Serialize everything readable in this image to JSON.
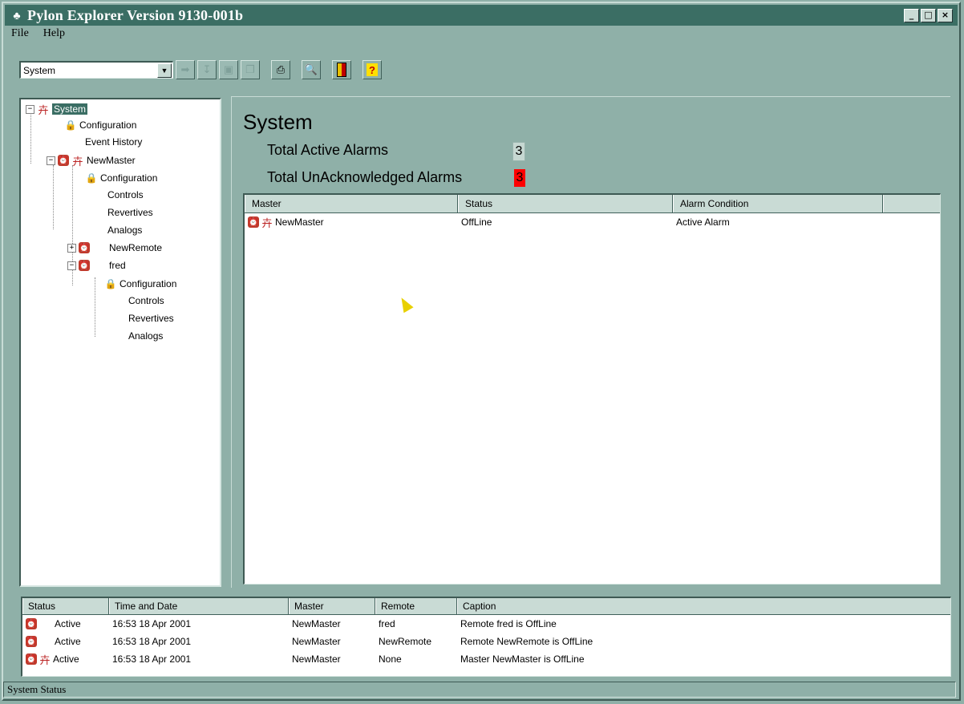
{
  "window": {
    "title": "Pylon Explorer Version 9130-001b",
    "controls": {
      "minimize": "_",
      "maximize": "□",
      "close": "×"
    }
  },
  "menu": {
    "file": "File",
    "help": "Help"
  },
  "toolbar": {
    "combo_value": "System",
    "buttons": [
      "forward-icon",
      "import-icon",
      "save-icon",
      "copy-icon",
      "print-icon",
      "search-icon",
      "book-icon",
      "help-icon"
    ]
  },
  "tree": {
    "root": "System",
    "items": {
      "config1": "Configuration",
      "event_history": "Event History",
      "newmaster": "NewMaster",
      "config2": "Configuration",
      "controls1": "Controls",
      "revertives1": "Revertives",
      "analogs1": "Analogs",
      "newremote": "NewRemote",
      "fred": "fred",
      "config3": "Configuration",
      "controls2": "Controls",
      "revertives2": "Revertives",
      "analogs2": "Analogs"
    }
  },
  "main": {
    "heading": "System",
    "total_active_label": "Total Active Alarms",
    "total_active_value": "3",
    "total_unack_label": "Total UnAcknowledged Alarms",
    "total_unack_value": "3",
    "columns": [
      "Master",
      "Status",
      "Alarm Condition",
      ""
    ],
    "rows": [
      {
        "master": "NewMaster",
        "status": "OffLine",
        "condition": "Active Alarm"
      }
    ]
  },
  "status_list": {
    "columns": [
      "Status",
      "Time and Date",
      "Master",
      "Remote",
      "Caption"
    ],
    "rows": [
      {
        "status": "Active",
        "time": "16:53 18 Apr 2001",
        "master": "NewMaster",
        "remote": "fred",
        "caption": "Remote fred is OffLine"
      },
      {
        "status": "Active",
        "time": "16:53 18 Apr 2001",
        "master": "NewMaster",
        "remote": "NewRemote",
        "caption": "Remote NewRemote is OffLine"
      },
      {
        "status": "Active",
        "time": "16:53 18 Apr 2001",
        "master": "NewMaster",
        "remote": "None",
        "caption": "Master NewMaster is OffLine"
      }
    ]
  },
  "statusbar": {
    "text": "System Status"
  },
  "colors": {
    "window_bg": "#8fb0a8",
    "title_bg": "#3b6e64",
    "alarm_red": "#ff0000"
  }
}
